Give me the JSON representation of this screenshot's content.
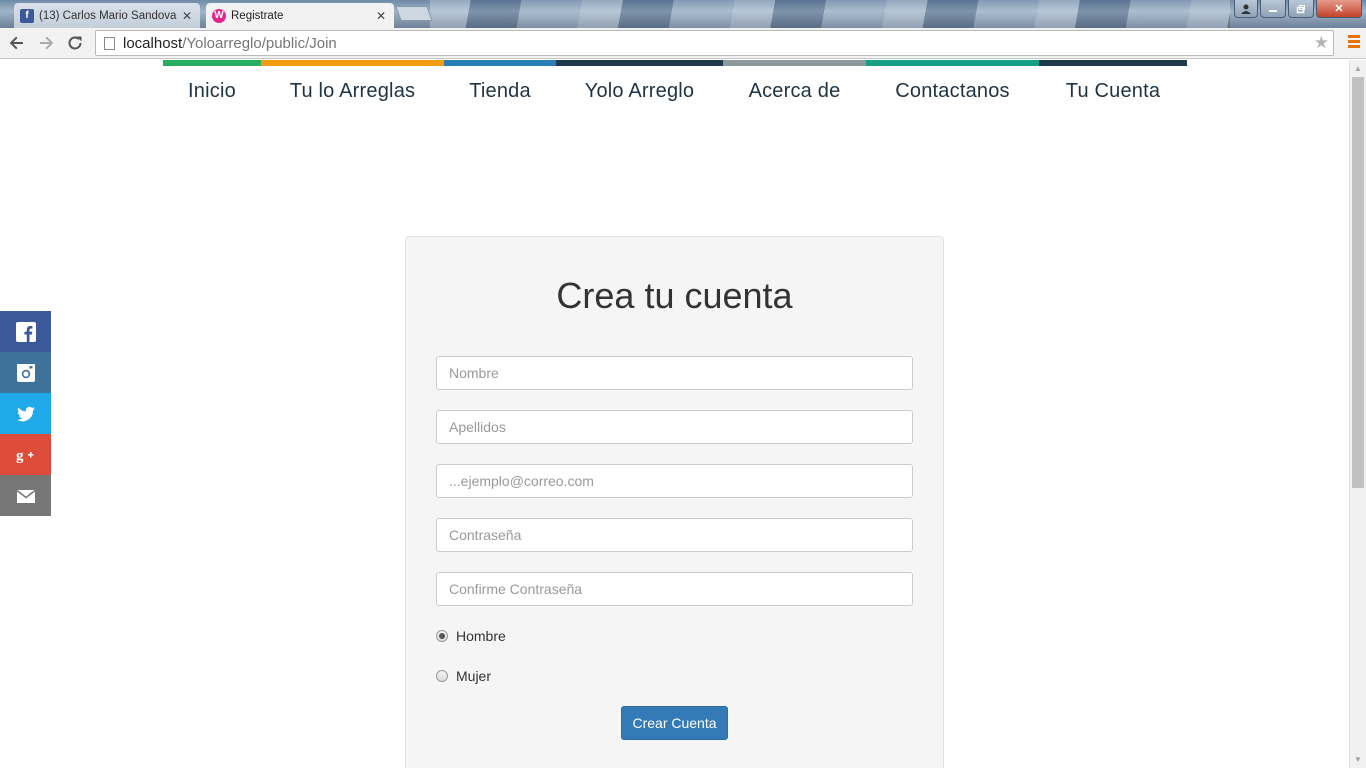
{
  "browser": {
    "tabs": [
      {
        "label": "(13) Carlos Mario Sandova",
        "favicon": "facebook-icon",
        "active": false
      },
      {
        "label": "Registrate",
        "favicon": "wamp-icon",
        "active": true
      }
    ],
    "url_host": "localhost",
    "url_path": "/Yoloarreglo/public/Join"
  },
  "nav": {
    "items": [
      {
        "label": "Inicio",
        "color": "#27ae60"
      },
      {
        "label": "Tu lo Arreglas",
        "color": "#f39c12"
      },
      {
        "label": "Tienda",
        "color": "#2980b9"
      },
      {
        "label": "Yolo Arreglo",
        "color": "#1f3a4d"
      },
      {
        "label": "Acerca de",
        "color": "#8c9a9c"
      },
      {
        "label": "Contactanos",
        "color": "#16a085"
      },
      {
        "label": "Tu Cuenta",
        "color": "#1f3a4d"
      }
    ]
  },
  "social": [
    {
      "icon": "facebook-icon",
      "color": "#3b5998"
    },
    {
      "icon": "instagram-icon",
      "color": "#3f729b"
    },
    {
      "icon": "twitter-icon",
      "color": "#1fa9e8"
    },
    {
      "icon": "google-plus-icon",
      "color": "#dd4b39"
    },
    {
      "icon": "email-icon",
      "color": "#777777"
    }
  ],
  "form": {
    "title": "Crea tu cuenta",
    "fields": {
      "nombre": "Nombre",
      "apellidos": "Apellidos",
      "email": "...ejemplo@correo.com",
      "password": "Contraseña",
      "confirm": "Confirme Contraseña"
    },
    "gender_options": [
      {
        "label": "Hombre",
        "selected": true
      },
      {
        "label": "Mujer",
        "selected": false
      }
    ],
    "submit_label": "Crear Cuenta",
    "submit_color": "#337ab7"
  }
}
